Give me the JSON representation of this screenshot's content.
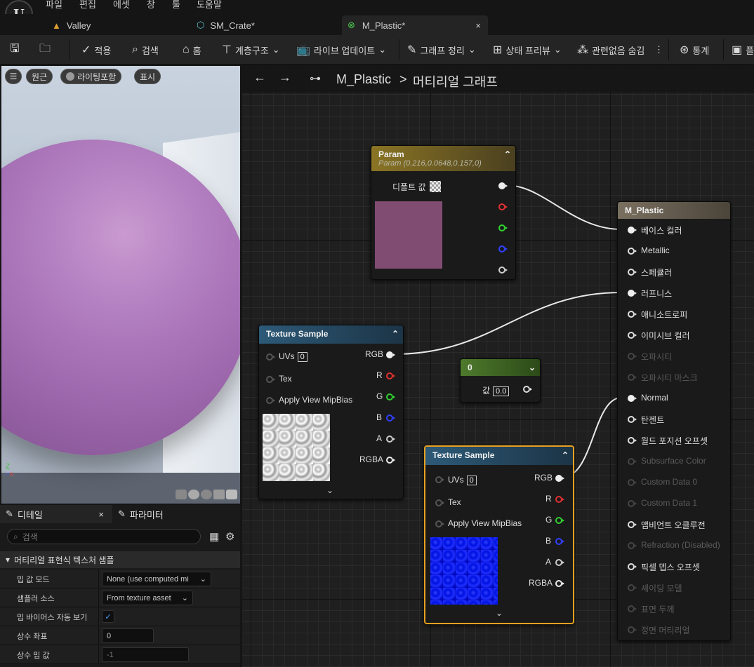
{
  "menu": {
    "file": "파일",
    "edit": "편집",
    "asset": "에셋",
    "window": "창",
    "tools": "툴",
    "help": "도움말"
  },
  "tabs": [
    {
      "label": "Valley"
    },
    {
      "label": "SM_Crate*"
    },
    {
      "label": "M_Plastic*"
    }
  ],
  "toolbar": {
    "apply": "적용",
    "search": "검색",
    "home": "홈",
    "hierarchy": "계층구조",
    "live_update": "라이브 업데이트",
    "clean_graph": "그래프 정리",
    "preview_state": "상태 프리뷰",
    "hide_unrelated": "관련없음 숨김",
    "stats": "통계",
    "platform": "플"
  },
  "viewport": {
    "perspective": "원근",
    "lit": "라이팅포함",
    "show": "표시"
  },
  "details": {
    "tab_details": "디테일",
    "tab_params": "파라미터",
    "search_placeholder": "검색",
    "section": "머티리얼 표현식 텍스처 샘플",
    "rows": [
      {
        "label": "밉 값 모드",
        "value": "None (use computed mi"
      },
      {
        "label": "샘플러 소스",
        "value": "From texture asset"
      },
      {
        "label": "밉 바이어스 자동 보기",
        "value": "✓"
      },
      {
        "label": "상수 좌표",
        "value": "0"
      },
      {
        "label": "상수 밉 값",
        "value": "-1"
      }
    ]
  },
  "graph": {
    "breadcrumb_asset": "M_Plastic",
    "breadcrumb_sep": ">",
    "breadcrumb_graph": "머티리얼 그래프",
    "param_node": {
      "title": "Param",
      "subtitle": "Param (0.216,0.0648,0.157,0)",
      "default_label": "디폴트 값",
      "swatch_color": "#804c72"
    },
    "texture_node_1": {
      "title": "Texture Sample",
      "pins_in": [
        "UVs",
        "Tex",
        "Apply View MipBias"
      ],
      "uv_value": "0",
      "pins_out": [
        "RGB",
        "R",
        "G",
        "B",
        "A",
        "RGBA"
      ]
    },
    "texture_node_2": {
      "title": "Texture Sample",
      "pins_in": [
        "UVs",
        "Tex",
        "Apply View MipBias"
      ],
      "uv_value": "0",
      "pins_out": [
        "RGB",
        "R",
        "G",
        "B",
        "A",
        "RGBA"
      ]
    },
    "const_node": {
      "title": "0",
      "value_label": "값",
      "value": "0.0"
    },
    "material_node": {
      "title": "M_Plastic",
      "inputs": [
        {
          "label": "베이스 컬러",
          "active": true
        },
        {
          "label": "Metallic",
          "active": true
        },
        {
          "label": "스페큘러",
          "active": true
        },
        {
          "label": "러프니스",
          "active": true
        },
        {
          "label": "애니소트로피",
          "active": true
        },
        {
          "label": "이미시브 컬러",
          "active": true
        },
        {
          "label": "오파시티",
          "active": false
        },
        {
          "label": "오파시티 마스크",
          "active": false
        },
        {
          "label": "Normal",
          "active": true
        },
        {
          "label": "탄젠트",
          "active": true
        },
        {
          "label": "월드 포지션 오프셋",
          "active": true
        },
        {
          "label": "Subsurface Color",
          "active": false
        },
        {
          "label": "Custom Data 0",
          "active": false
        },
        {
          "label": "Custom Data 1",
          "active": false
        },
        {
          "label": "앰비언트 오클루전",
          "active": true
        },
        {
          "label": "Refraction (Disabled)",
          "active": false
        },
        {
          "label": "픽셀 뎁스 오프셋",
          "active": true
        },
        {
          "label": "셰이딩 모델",
          "active": false
        },
        {
          "label": "표면 두께",
          "active": false
        },
        {
          "label": "정면 머티리얼",
          "active": false
        }
      ]
    }
  },
  "colors": {
    "param_header": "#8a7424",
    "texture_header": "#2d5a78",
    "const_header": "#4e7a2c",
    "material_header": "#6e6658",
    "selection": "#e8a020"
  }
}
